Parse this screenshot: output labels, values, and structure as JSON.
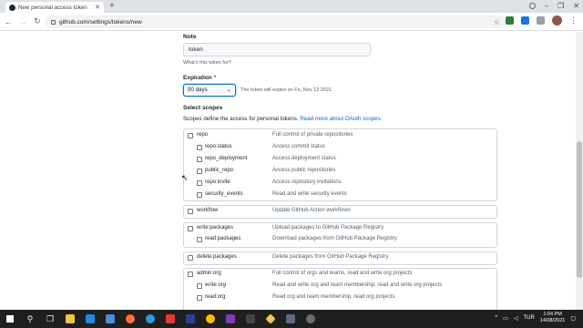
{
  "browser": {
    "tab_title": "New personal access token",
    "url": "github.com/settings/tokens/new"
  },
  "form": {
    "note_label": "Note",
    "note_value": "token",
    "note_help": "What's this token for?",
    "expiration_label": "Expiration",
    "expiration_required": "*",
    "expiration_value": "90 days",
    "expiration_note": "The token will expire on Fri, Nov 12 2021",
    "scopes_label": "Select scopes",
    "scopes_desc": "Scopes define the access for personal tokens.",
    "scopes_link": "Read more about OAuth scopes."
  },
  "scopes": {
    "repo": {
      "name": "repo",
      "desc": "Full control of private repositories"
    },
    "repo_status": {
      "name": "repo:status",
      "desc": "Access commit status"
    },
    "repo_deployment": {
      "name": "repo_deployment",
      "desc": "Access deployment status"
    },
    "public_repo": {
      "name": "public_repo",
      "desc": "Access public repositories"
    },
    "repo_invite": {
      "name": "repo:invite",
      "desc": "Access repository invitations"
    },
    "security_events": {
      "name": "security_events",
      "desc": "Read and write security events"
    },
    "workflow": {
      "name": "workflow",
      "desc": "Update GitHub Action workflows"
    },
    "write_packages": {
      "name": "write:packages",
      "desc": "Upload packages to GitHub Package Registry"
    },
    "read_packages": {
      "name": "read:packages",
      "desc": "Download packages from GitHub Package Registry"
    },
    "delete_packages": {
      "name": "delete:packages",
      "desc": "Delete packages from GitHub Package Registry"
    },
    "admin_org": {
      "name": "admin:org",
      "desc": "Full control of orgs and teams, read and write org projects"
    },
    "write_org": {
      "name": "write:org",
      "desc": "Read and write org and team membership, read and write org projects"
    },
    "read_org": {
      "name": "read:org",
      "desc": "Read org and team membership, read org projects"
    }
  },
  "taskbar": {
    "lang": "TUR",
    "time": "1:04 PM",
    "date": "14/08/2021"
  },
  "colors": {
    "link": "#0969da",
    "required": "#cf222e",
    "taskbar": "#1f1f1f"
  }
}
